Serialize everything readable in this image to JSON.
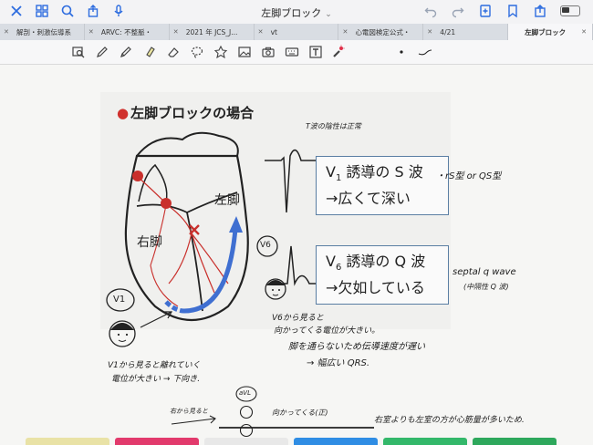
{
  "app": {
    "document_title": "左脚ブロック",
    "title_chevron": "⌄"
  },
  "tabs": [
    {
      "label": "解剖・刺激伝導系",
      "active": false
    },
    {
      "label": "ARVC: 不整脈・",
      "active": false
    },
    {
      "label": "2021 年 JCS_J...",
      "active": false
    },
    {
      "label": "vt",
      "active": false
    },
    {
      "label": "心電図検定公式・",
      "active": false
    },
    {
      "label": "4/21",
      "active": false
    },
    {
      "label": "左脚ブロック",
      "active": true
    }
  ],
  "slide": {
    "title": "左脚ブロックの場合",
    "left_ventricle_label": "左脚",
    "right_ventricle_label": "右脚",
    "v1_box": {
      "lead": "V",
      "lead_sub": "1",
      "text": "誘導の S 波",
      "line2": "→広くて深い"
    },
    "v6_box": {
      "lead": "V",
      "lead_sub": "6",
      "text": "誘導の Q 波",
      "line2": "→欠如している"
    },
    "v6_marker": "V6",
    "v1_marker": "V1"
  },
  "handwriting": {
    "above_v1_wave": "T波の陰性は正常",
    "v1_note": "・rS型 or QS型",
    "v6_note": "septal q wave",
    "v6_note2": "(中隔性 Q 波)",
    "v6_explain_1": "V6から見ると",
    "v6_explain_2": "向かってくる電位が大きい。",
    "v6_explain_3": "脚を通らないため伝導速度が遅い",
    "v6_explain_4": "→ 幅広い QRS.",
    "v1_explain_1": "V1から見ると離れていく",
    "v1_explain_2": "電位が大きい → 下向き.",
    "bottom_left": "右から見ると",
    "bottom_avl": "aVL",
    "bottom_mid": "向かってくる(正)",
    "bottom_right": "右室よりも左室の方が心筋量が多いため."
  },
  "colors": {
    "accent": "#2d6cdf",
    "title_dot": "#d0312d",
    "box_border": "#5a7ea3",
    "active_tab": "#f7f7f9",
    "arrow_blue": "#3f6fd1",
    "conduction_red": "#c9302c"
  },
  "dock_colors": [
    "#e9e2a6",
    "#e23a6c",
    "#e8e8e8",
    "#2f8de4",
    "#33b86a",
    "#2ea85c",
    "#3ab36e"
  ]
}
